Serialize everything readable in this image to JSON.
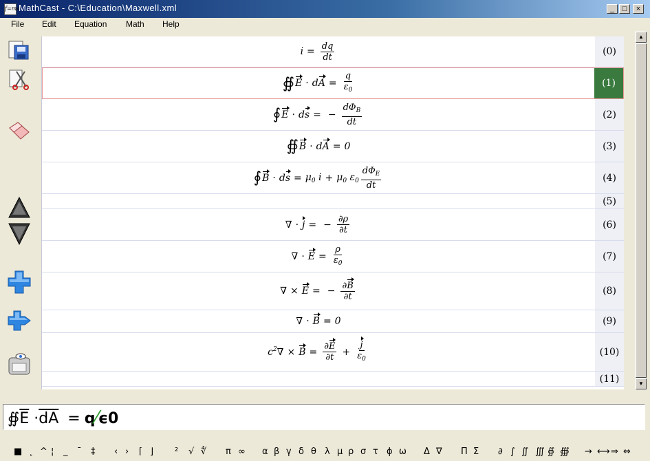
{
  "window": {
    "app_icon_label": "f=ma",
    "title": "MathCast - C:\\Education\\Maxwell.xml",
    "controls": {
      "minimize": "_",
      "maximize": "□",
      "close": "×"
    }
  },
  "menu": [
    "File",
    "Edit",
    "Equation",
    "Math",
    "Help"
  ],
  "toolbar": [
    {
      "name": "save-icon"
    },
    {
      "name": "cut-icon"
    },
    {
      "name": "eraser-icon"
    },
    {
      "name": "move-up-icon"
    },
    {
      "name": "move-down-icon"
    },
    {
      "name": "add-equation-icon"
    },
    {
      "name": "insert-equation-icon"
    },
    {
      "name": "screen-reader-icon"
    }
  ],
  "selected_equation": 1,
  "equations": [
    {
      "number": "(0)",
      "label": "i = dq/dt"
    },
    {
      "number": "(1)",
      "label": "∯ E · dA = q/ε0"
    },
    {
      "number": "(2)",
      "label": "∮ E · ds = −dΦB/dt"
    },
    {
      "number": "(3)",
      "label": "∯ B · dA = 0"
    },
    {
      "number": "(4)",
      "label": "∮ B · ds = μ0 i + μ0 ε0 dΦE/dt"
    },
    {
      "number": "(5)",
      "label": ""
    },
    {
      "number": "(6)",
      "label": "∇ · j = −∂ρ/∂t"
    },
    {
      "number": "(7)",
      "label": "∇ · E = ρ/ε0"
    },
    {
      "number": "(8)",
      "label": "∇ × E = −∂B/∂t"
    },
    {
      "number": "(9)",
      "label": "∇ · B = 0"
    },
    {
      "number": "(10)",
      "label": "c²∇ × B = ∂E/∂t + j/ε0"
    },
    {
      "number": "(11)",
      "label": ""
    }
  ],
  "editor": {
    "integral": "∯",
    "field": "E",
    "dot": "·",
    "diff": "dA",
    "equals": "=",
    "numerator": "q",
    "slash": "⁄",
    "denominator": "ϵ0"
  },
  "symbols": [
    "■",
    "˛",
    "^",
    "¦",
    "_",
    "¯",
    "‡",
    "‹",
    "›",
    "⌈",
    "⌋",
    "²",
    "√",
    "∜",
    "π",
    "∞",
    "α",
    "β",
    "γ",
    "δ",
    "θ",
    "λ",
    "μ",
    "ρ",
    "σ",
    "τ",
    "ϕ",
    "ω",
    "Δ",
    "∇",
    "Π",
    "Σ",
    "∂",
    "∫",
    "∬",
    "∭",
    "∯",
    "∰",
    "→",
    "⟷",
    "⇒",
    "⇔"
  ],
  "colors": {
    "title_gradient_start": "#0a246a",
    "title_gradient_end": "#a6caf0",
    "selected_number_bg": "#3a7a3e",
    "selected_border": "#e89898",
    "number_column_bg": "#eef0f6",
    "slash_color": "#2e9e2e"
  }
}
